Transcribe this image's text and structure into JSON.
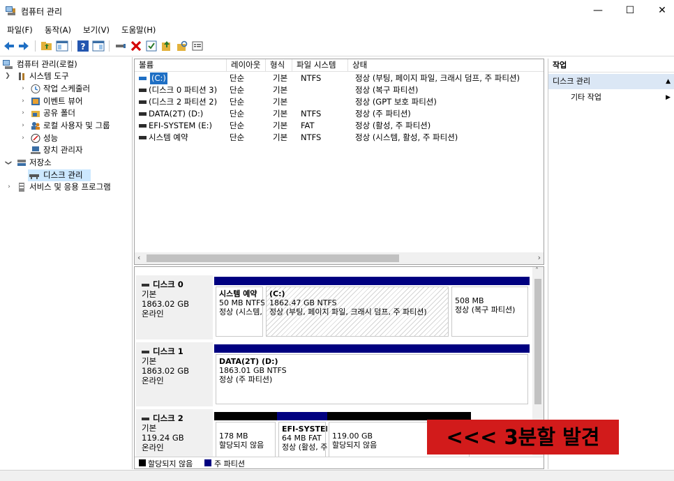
{
  "window": {
    "title": "컴퓨터 관리",
    "minimize": "—",
    "maximize": "☐",
    "close": "✕"
  },
  "menu": [
    "파일(F)",
    "동작(A)",
    "보기(V)",
    "도움말(H)"
  ],
  "tree": {
    "root": "컴퓨터 관리(로컬)",
    "system_tools": "시스템 도구",
    "task_scheduler": "작업 스케줄러",
    "event_viewer": "이벤트 뷰어",
    "shared_folders": "공유 폴더",
    "local_users": "로컬 사용자 및 그룹",
    "performance": "성능",
    "device_manager": "장치 관리자",
    "storage": "저장소",
    "disk_management": "디스크 관리",
    "services": "서비스 및 응용 프로그램"
  },
  "volume_list": {
    "headers": [
      "볼륨",
      "레이아웃",
      "형식",
      "파일 시스템",
      "상태"
    ],
    "rows": [
      [
        "(C:)",
        "단순",
        "기본",
        "NTFS",
        "정상 (부팅, 페이지 파일, 크래시 덤프, 주 파티션)"
      ],
      [
        "(디스크 0 파티션 3)",
        "단순",
        "기본",
        "",
        "정상 (복구 파티션)"
      ],
      [
        "(디스크 2 파티션 2)",
        "단순",
        "기본",
        "",
        "정상 (GPT 보호 파티션)"
      ],
      [
        "DATA(2T) (D:)",
        "단순",
        "기본",
        "NTFS",
        "정상 (주 파티션)"
      ],
      [
        "EFI-SYSTEM (E:)",
        "단순",
        "기본",
        "FAT",
        "정상 (활성, 주 파티션)"
      ],
      [
        "시스템 예약",
        "단순",
        "기본",
        "NTFS",
        "정상 (시스템, 활성, 주 파티션)"
      ]
    ]
  },
  "disks": [
    {
      "name": "디스크 0",
      "type": "기본",
      "size": "1863.02 GB",
      "status": "온라인",
      "partitions": [
        {
          "title": "시스템 예약",
          "size": "50 MB NTFS",
          "status": "정상 (시스템, 활성, 주 파티션)"
        },
        {
          "title": "(C:)",
          "size": "1862.47 GB NTFS",
          "status": "정상 (부팅, 페이지 파일, 크래시 덤프, 주 파티션)"
        },
        {
          "title": "",
          "size": "508 MB",
          "status": "정상 (복구 파티션)"
        }
      ]
    },
    {
      "name": "디스크 1",
      "type": "기본",
      "size": "1863.02 GB",
      "status": "온라인",
      "partitions": [
        {
          "title": "DATA(2T)  (D:)",
          "size": "1863.01 GB NTFS",
          "status": "정상 (주 파티션)"
        }
      ]
    },
    {
      "name": "디스크 2",
      "type": "기본",
      "size": "119.24 GB",
      "status": "온라인",
      "partitions": [
        {
          "title": "",
          "size": "178 MB",
          "status": "할당되지 않음"
        },
        {
          "title": "EFI-SYSTEM",
          "size": "64 MB FAT",
          "status": "정상 (활성, 주 파티션)"
        },
        {
          "title": "",
          "size": "119.00 GB",
          "status": "할당되지 않음"
        }
      ]
    }
  ],
  "legend": {
    "unallocated": "할당되지 않음",
    "primary": "주 파티션"
  },
  "actions": {
    "header": "작업",
    "section": "디스크 관리",
    "more": "기타 작업"
  },
  "overlay_text": "<<< 3분할 발견",
  "colors": {
    "primary_partition": "#000080",
    "unallocated": "#000000",
    "selection": "#cce8ff",
    "overlay": "#d21b1b"
  }
}
